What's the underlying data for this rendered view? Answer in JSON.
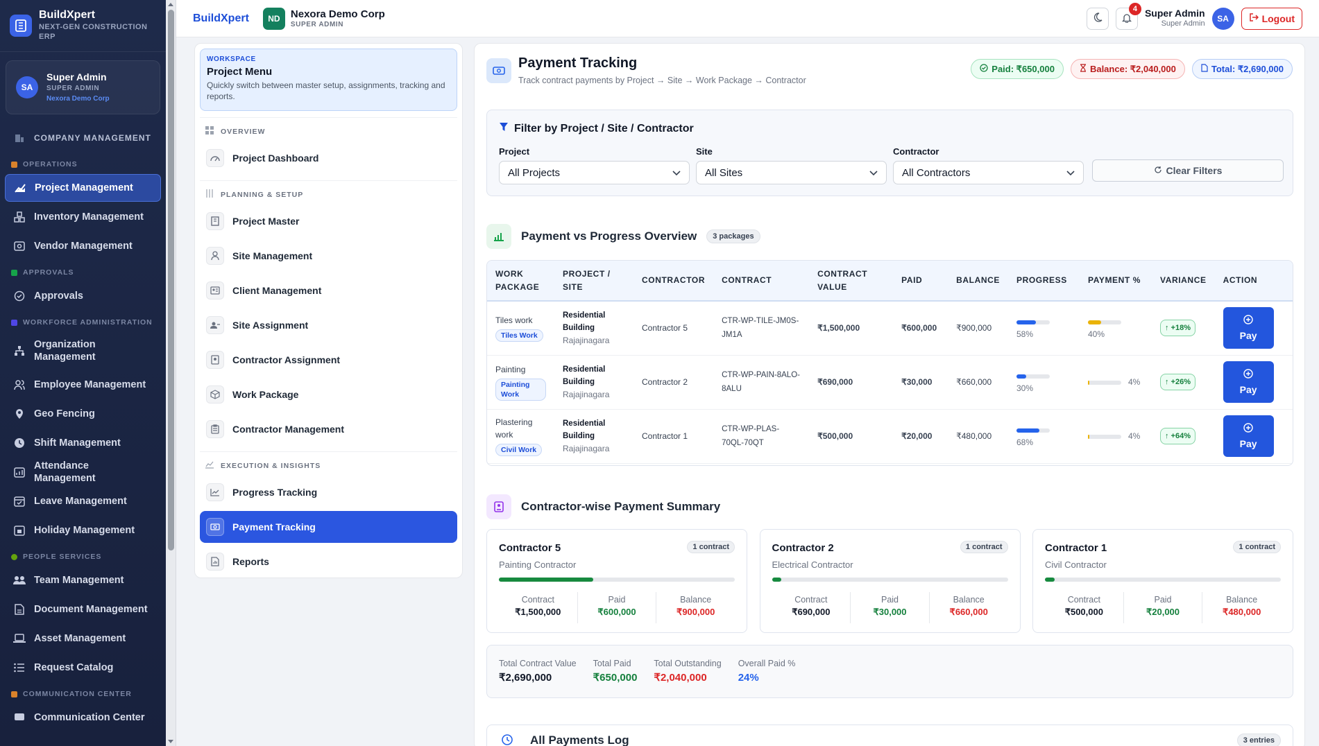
{
  "sidebar": {
    "brand": {
      "name": "BuildXpert",
      "tagline": "NEXT-GEN CONSTRUCTION ERP"
    },
    "user": {
      "initials": "SA",
      "name": "Super Admin",
      "role": "SUPER ADMIN",
      "org": "Nexora Demo Corp"
    },
    "company_label": "COMPANY MANAGEMENT",
    "sections": {
      "operations": "OPERATIONS",
      "approvals": "APPROVALS",
      "workforce": "WORKFORCE ADMINISTRATION",
      "people": "PEOPLE SERVICES",
      "communication": "COMMUNICATION CENTER"
    },
    "items": {
      "project": "Project Management",
      "inventory": "Inventory Management",
      "vendor": "Vendor Management",
      "approvals": "Approvals",
      "organization": "Organization Management",
      "employee": "Employee Management",
      "geo": "Geo Fencing",
      "shift": "Shift Management",
      "attendance": "Attendance Management",
      "leave": "Leave Management",
      "holiday": "Holiday Management",
      "team": "Team Management",
      "document": "Document Management",
      "asset": "Asset Management",
      "request": "Request Catalog",
      "communication": "Communication Center"
    }
  },
  "topbar": {
    "brand": "BuildXpert",
    "org_initials": "ND",
    "org_name": "Nexora Demo Corp",
    "org_role": "SUPER ADMIN",
    "notification_count": "4",
    "user_name": "Super Admin",
    "user_role": "Super Admin",
    "user_initials": "SA",
    "logout": "Logout"
  },
  "project_menu": {
    "workspace_tag": "WORKSPACE",
    "title": "Project Menu",
    "description": "Quickly switch between master setup, assignments, tracking and reports.",
    "sections": {
      "overview": "OVERVIEW",
      "planning": "PLANNING & SETUP",
      "execution": "EXECUTION & INSIGHTS"
    },
    "items": {
      "dashboard": "Project Dashboard",
      "master": "Project Master",
      "site": "Site Management",
      "client": "Client Management",
      "site_assignment": "Site Assignment",
      "contractor_assignment": "Contractor Assignment",
      "work_package": "Work Package",
      "contractor_management": "Contractor Management",
      "progress": "Progress Tracking",
      "payment": "Payment Tracking",
      "reports": "Reports"
    }
  },
  "page": {
    "title": "Payment Tracking",
    "subtitle": "Track contract payments by Project → Site → Work Package → Contractor",
    "pills": {
      "paid": "Paid: ₹650,000",
      "balance": "Balance: ₹2,040,000",
      "total": "Total: ₹2,690,000"
    }
  },
  "filter": {
    "title": "Filter by Project / Site / Contractor",
    "project_label": "Project",
    "project_value": "All Projects",
    "site_label": "Site",
    "site_value": "All Sites",
    "contractor_label": "Contractor",
    "contractor_value": "All Contractors",
    "clear": "Clear Filters"
  },
  "overview": {
    "title": "Payment vs Progress Overview",
    "count": "3 packages",
    "columns": [
      "WORK PACKAGE",
      "PROJECT / SITE",
      "CONTRACTOR",
      "CONTRACT",
      "CONTRACT VALUE",
      "PAID",
      "BALANCE",
      "PROGRESS",
      "PAYMENT %",
      "VARIANCE",
      "ACTION"
    ],
    "rows": [
      {
        "package": "Tiles work",
        "tag": "Tiles Work",
        "project": "Residential Building",
        "site": "Rajajinagara",
        "contractor": "Contractor 5",
        "contract": "CTR-WP-TILE-JM0S-JM1A",
        "value": "₹1,500,000",
        "paid": "₹600,000",
        "balance": "₹900,000",
        "progress": 58,
        "progress_text": "58%",
        "payment": 40,
        "payment_text": "40%",
        "variance": "↑ +18%",
        "action": "Pay"
      },
      {
        "package": "Painting",
        "tag": "Painting Work",
        "project": "Residential Building",
        "site": "Rajajinagara",
        "contractor": "Contractor 2",
        "contract": "CTR-WP-PAIN-8ALO-8ALU",
        "value": "₹690,000",
        "paid": "₹30,000",
        "balance": "₹660,000",
        "progress": 30,
        "progress_text": "30%",
        "payment": 4,
        "payment_text": "4%",
        "variance": "↑ +26%",
        "action": "Pay"
      },
      {
        "package": "Plastering work",
        "tag": "Civil Work",
        "project": "Residential Building",
        "site": "Rajajinagara",
        "contractor": "Contractor 1",
        "contract": "CTR-WP-PLAS-70QL-70QT",
        "value": "₹500,000",
        "paid": "₹20,000",
        "balance": "₹480,000",
        "progress": 68,
        "progress_text": "68%",
        "payment": 4,
        "payment_text": "4%",
        "variance": "↑ +64%",
        "action": "Pay"
      }
    ]
  },
  "summary": {
    "title": "Contractor-wise Payment Summary",
    "labels": {
      "contract": "Contract",
      "paid": "Paid",
      "balance": "Balance"
    },
    "cards": [
      {
        "name": "Contractor 5",
        "role": "Painting Contractor",
        "count": "1 contract",
        "paid_fraction": 0.4,
        "contract": "₹1,500,000",
        "paid": "₹600,000",
        "balance": "₹900,000"
      },
      {
        "name": "Contractor 2",
        "role": "Electrical Contractor",
        "count": "1 contract",
        "paid_fraction": 0.04,
        "contract": "₹690,000",
        "paid": "₹30,000",
        "balance": "₹660,000"
      },
      {
        "name": "Contractor 1",
        "role": "Civil Contractor",
        "count": "1 contract",
        "paid_fraction": 0.04,
        "contract": "₹500,000",
        "paid": "₹20,000",
        "balance": "₹480,000"
      }
    ]
  },
  "totals": {
    "contract_label": "Total Contract Value",
    "contract_value": "₹2,690,000",
    "paid_label": "Total Paid",
    "paid_value": "₹650,000",
    "outstanding_label": "Total Outstanding",
    "outstanding_value": "₹2,040,000",
    "overall_label": "Overall Paid %",
    "overall_value": "24%"
  },
  "log": {
    "title": "All Payments Log",
    "count": "3 entries"
  },
  "colors": {
    "accent": "#2356dd",
    "paid": "#15803d",
    "balance": "#dc2626",
    "sidebar": "#1e2a4a"
  }
}
